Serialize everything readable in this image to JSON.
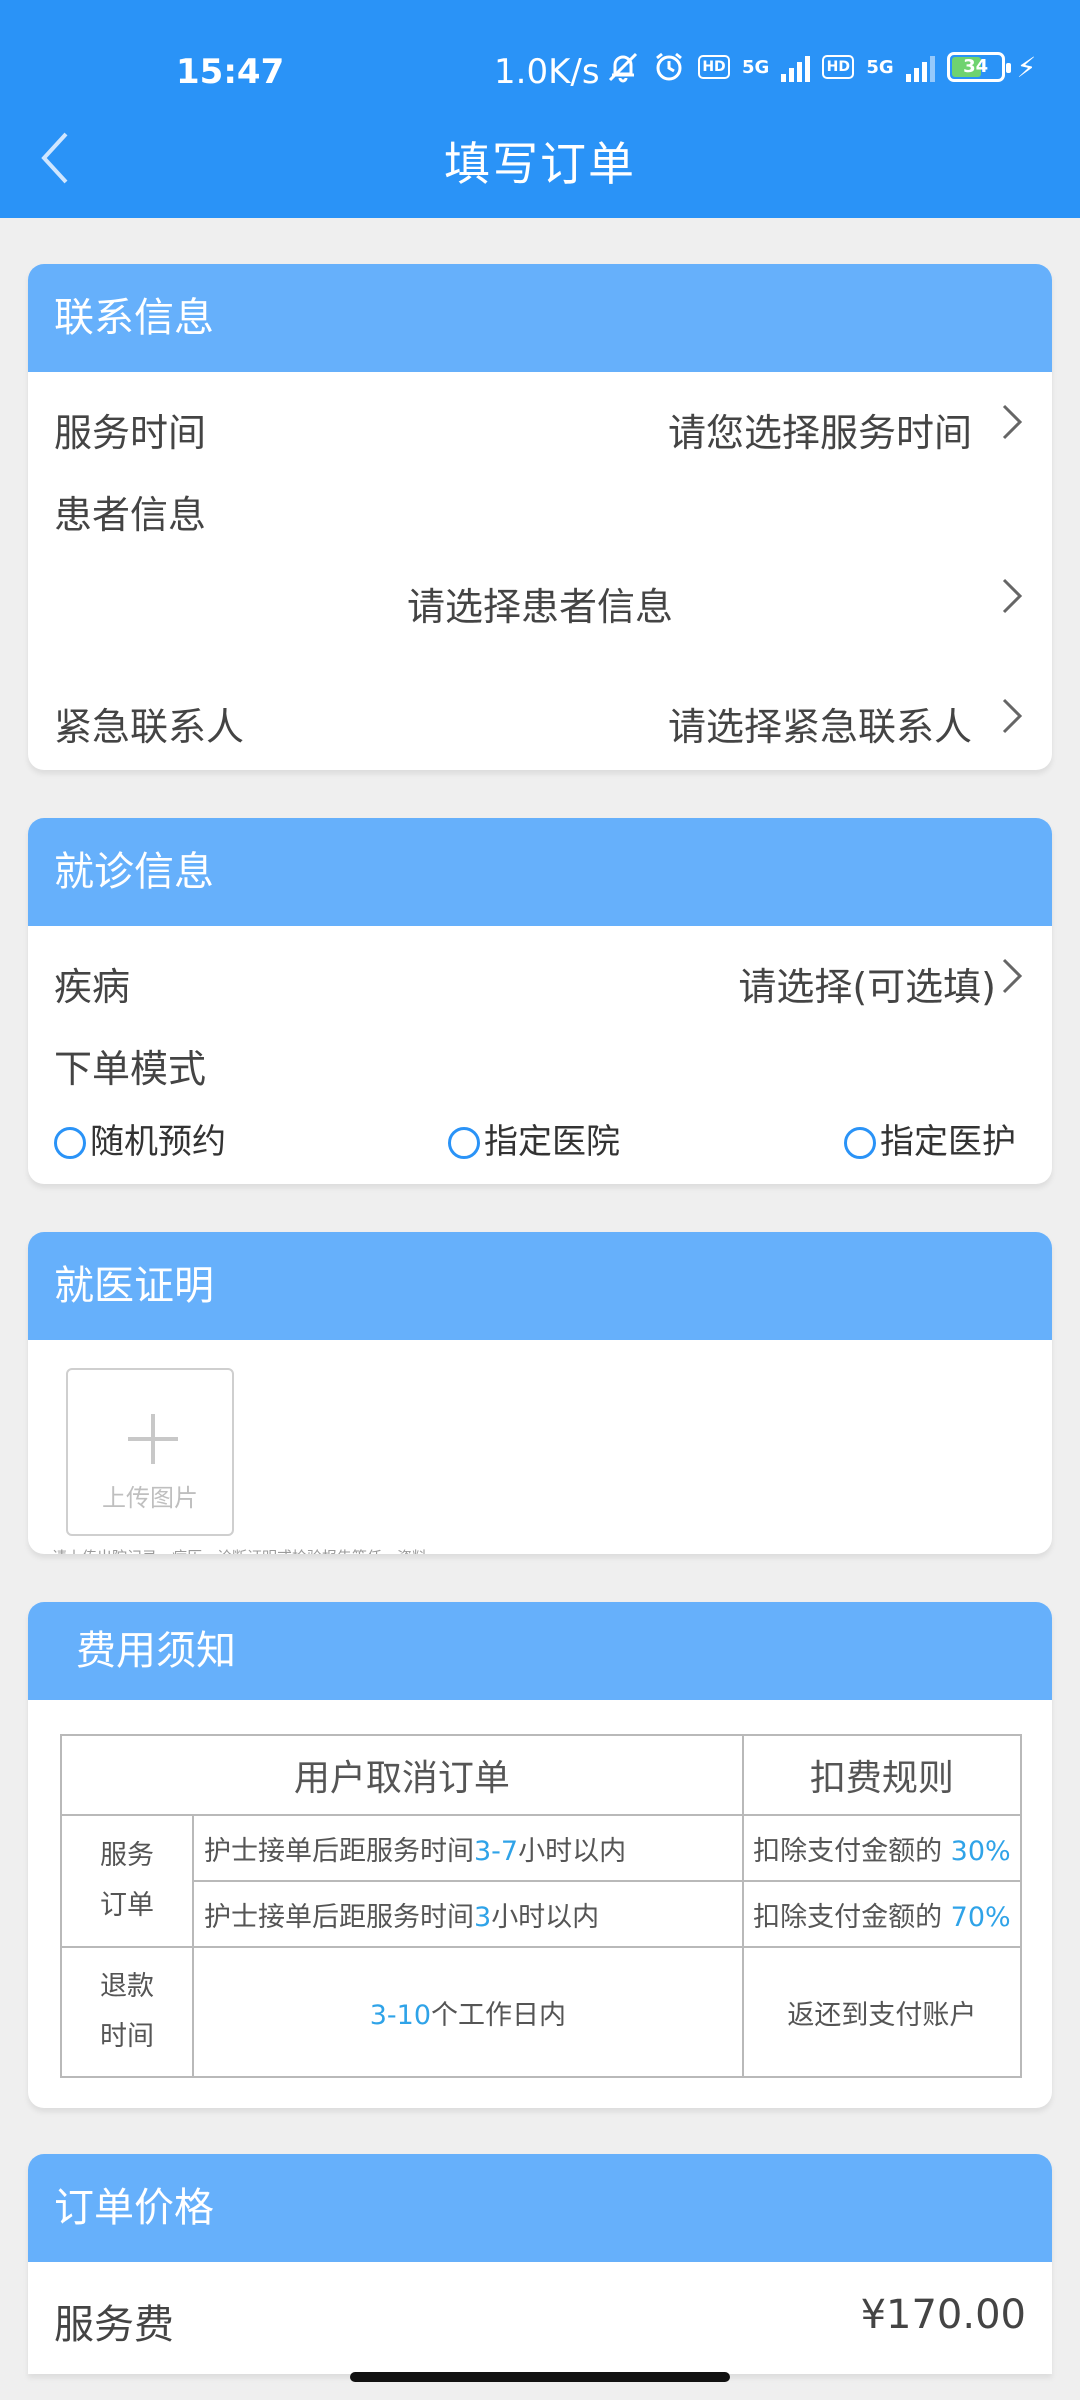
{
  "status_bar": {
    "time": "15:47",
    "net_speed": "1.0K/s",
    "battery": "34",
    "sim1_badge": "HD",
    "sim1_net": "5G",
    "sim2_badge": "HD",
    "sim2_net": "5G"
  },
  "header": {
    "title": "填写订单"
  },
  "contact": {
    "title": "联系信息",
    "service_time_label": "服务时间",
    "service_time_value": "请您选择服务时间",
    "patient_label": "患者信息",
    "patient_value": "请选择患者信息",
    "emergency_label": "紧急联系人",
    "emergency_value": "请选择紧急联系人"
  },
  "visit": {
    "title": "就诊信息",
    "disease_label": "疾病",
    "disease_value": "请选择(可选填)",
    "mode_label": "下单模式",
    "options": [
      "随机预约",
      "指定医院",
      "指定医护"
    ]
  },
  "proof": {
    "title": "就医证明",
    "upload_label": "上传图片",
    "tip": "请上传出院记录、病历、诊断证明或检验报告等任一资料"
  },
  "fee": {
    "title": "费用须知",
    "col_cancel": "用户取消订单",
    "col_rule": "扣费规则",
    "service_order_label_1": "服务",
    "service_order_label_2": "订单",
    "row1_prefix": "护士接单后距服务时间",
    "row1_highlight": "3-7",
    "row1_suffix": "小时以内",
    "row1_rule_prefix": "扣除支付金额的 ",
    "row1_rule_pct": "30%",
    "row2_prefix": "护士接单后距服务时间",
    "row2_highlight": "3",
    "row2_suffix": "小时以内",
    "row2_rule_prefix": "扣除支付金额的 ",
    "row2_rule_pct": "70%",
    "refund_label_1": "退款",
    "refund_label_2": "时间",
    "refund_highlight": "3-10",
    "refund_suffix": "个工作日内",
    "refund_rule": "返还到支付账户"
  },
  "price": {
    "title": "订单价格",
    "service_fee_label": "服务费",
    "service_fee_value": "¥170.00"
  }
}
